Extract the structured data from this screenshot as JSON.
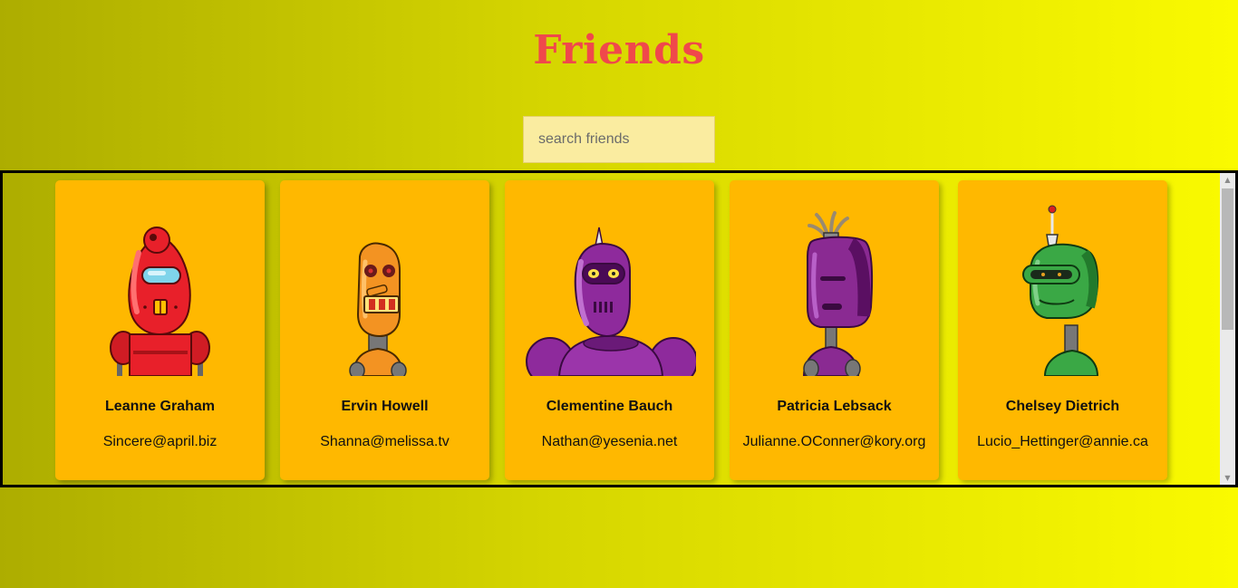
{
  "header": {
    "title": "Friends"
  },
  "search": {
    "placeholder": "search friends",
    "value": ""
  },
  "robots": [
    {
      "name": "Leanne Graham",
      "email": "Sincere@april.biz",
      "color": "#e8202a"
    },
    {
      "name": "Ervin Howell",
      "email": "Shanna@melissa.tv",
      "color": "#f39322"
    },
    {
      "name": "Clementine Bauch",
      "email": "Nathan@yesenia.net",
      "color": "#8e2a9c"
    },
    {
      "name": "Patricia Lebsack",
      "email": "Julianne.OConner@kory.org",
      "color": "#8a2a92"
    },
    {
      "name": "Chelsey Dietrich",
      "email": "Lucio_Hettinger@annie.ca",
      "color": "#3aa845"
    }
  ],
  "colors": {
    "background_start": "#adad00",
    "background_end": "#fafa00",
    "title": "#f0484b",
    "card": "#ffb800",
    "search_field": "#faeca0"
  }
}
